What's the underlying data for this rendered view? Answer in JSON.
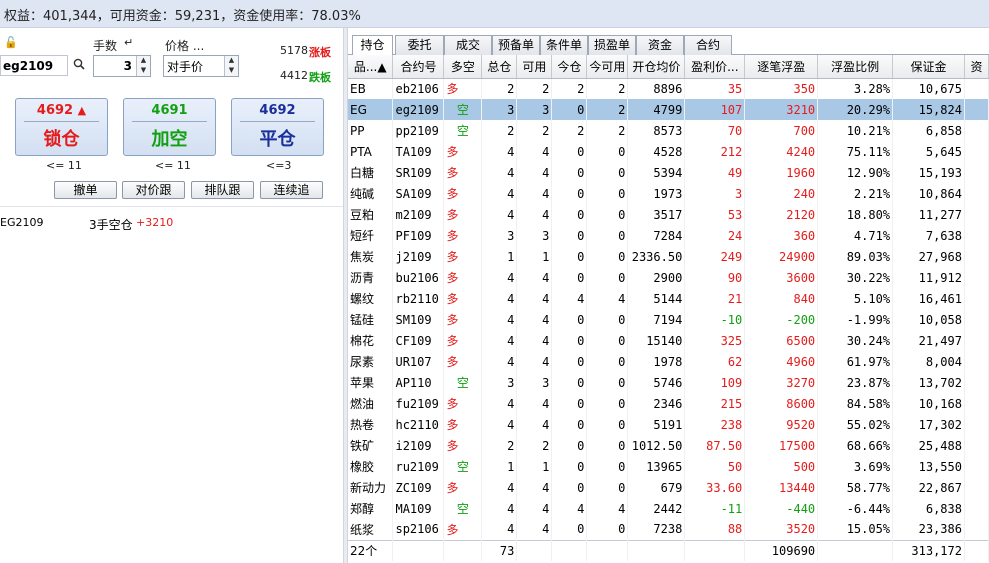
{
  "status": {
    "text": "权益：401,344，可用资金：59,231，资金使用率：78.03%"
  },
  "order": {
    "lock_icon": "lock-icon",
    "symbol": "eg2109",
    "lots_label": "手数",
    "lots": "3",
    "price_label": "价格 ...",
    "price_mode": "对手价",
    "limit_up": "5178",
    "limit_up_label": "涨板",
    "limit_down": "4412",
    "limit_down_label": "跌板",
    "buttons": [
      {
        "price": "4692",
        "title": "锁仓",
        "limit": "<= 11",
        "price_color": "#e51c1c",
        "title_color": "#e51c1c",
        "arrow": "▲"
      },
      {
        "price": "4691",
        "title": "加空",
        "limit": "<= 11",
        "price_color": "#12a012",
        "title_color": "#12a012",
        "arrow": ""
      },
      {
        "price": "4692",
        "title": "平仓",
        "limit": "<=3",
        "price_color": "#1a2f9a",
        "title_color": "#1a2f9a",
        "arrow": ""
      }
    ],
    "small_buttons": [
      "撤单",
      "对价跟",
      "排队跟",
      "连续追"
    ],
    "position": {
      "code": "EG2109",
      "desc": "3手空仓",
      "pl": "+3210"
    }
  },
  "tabs": [
    "持仓",
    "委托",
    "成交",
    "预备单",
    "条件单",
    "损盈单",
    "资金",
    "合约"
  ],
  "table": {
    "headers": [
      "品...▲",
      "合约号",
      "多空",
      "总仓",
      "可用",
      "今仓",
      "今可用",
      "开仓均价",
      "盈利价...",
      "逐笔浮盈",
      "浮盈比例",
      "保证金",
      "资"
    ],
    "rows": [
      [
        "EB",
        "eb2106",
        "多",
        "2",
        "2",
        "2",
        "2",
        "8896",
        "35",
        "350",
        "3.28%",
        "10,675"
      ],
      [
        "EG",
        "eg2109",
        "空",
        "3",
        "3",
        "0",
        "2",
        "4799",
        "107",
        "3210",
        "20.29%",
        "15,824"
      ],
      [
        "PP",
        "pp2109",
        "空",
        "2",
        "2",
        "2",
        "2",
        "8573",
        "70",
        "700",
        "10.21%",
        "6,858"
      ],
      [
        "PTA",
        "TA109",
        "多",
        "4",
        "4",
        "0",
        "0",
        "4528",
        "212",
        "4240",
        "75.11%",
        "5,645"
      ],
      [
        "白糖",
        "SR109",
        "多",
        "4",
        "4",
        "0",
        "0",
        "5394",
        "49",
        "1960",
        "12.90%",
        "15,193"
      ],
      [
        "纯碱",
        "SA109",
        "多",
        "4",
        "4",
        "0",
        "0",
        "1973",
        "3",
        "240",
        "2.21%",
        "10,864"
      ],
      [
        "豆粕",
        "m2109",
        "多",
        "4",
        "4",
        "0",
        "0",
        "3517",
        "53",
        "2120",
        "18.80%",
        "11,277"
      ],
      [
        "短纤",
        "PF109",
        "多",
        "3",
        "3",
        "0",
        "0",
        "7284",
        "24",
        "360",
        "4.71%",
        "7,638"
      ],
      [
        "焦炭",
        "j2109",
        "多",
        "1",
        "1",
        "0",
        "0",
        "2336.50",
        "249",
        "24900",
        "89.03%",
        "27,968"
      ],
      [
        "沥青",
        "bu2106",
        "多",
        "4",
        "4",
        "0",
        "0",
        "2900",
        "90",
        "3600",
        "30.22%",
        "11,912"
      ],
      [
        "螺纹",
        "rb2110",
        "多",
        "4",
        "4",
        "4",
        "4",
        "5144",
        "21",
        "840",
        "5.10%",
        "16,461"
      ],
      [
        "锰硅",
        "SM109",
        "多",
        "4",
        "4",
        "0",
        "0",
        "7194",
        "-10",
        "-200",
        "-1.99%",
        "10,058"
      ],
      [
        "棉花",
        "CF109",
        "多",
        "4",
        "4",
        "0",
        "0",
        "15140",
        "325",
        "6500",
        "30.24%",
        "21,497"
      ],
      [
        "尿素",
        "UR107",
        "多",
        "4",
        "4",
        "0",
        "0",
        "1978",
        "62",
        "4960",
        "61.97%",
        "8,004"
      ],
      [
        "苹果",
        "AP110",
        "空",
        "3",
        "3",
        "0",
        "0",
        "5746",
        "109",
        "3270",
        "23.87%",
        "13,702"
      ],
      [
        "燃油",
        "fu2109",
        "多",
        "4",
        "4",
        "0",
        "0",
        "2346",
        "215",
        "8600",
        "84.58%",
        "10,168"
      ],
      [
        "热卷",
        "hc2110",
        "多",
        "4",
        "4",
        "0",
        "0",
        "5191",
        "238",
        "9520",
        "55.02%",
        "17,302"
      ],
      [
        "铁矿",
        "i2109",
        "多",
        "2",
        "2",
        "0",
        "0",
        "1012.50",
        "87.50",
        "17500",
        "68.66%",
        "25,488"
      ],
      [
        "橡胶",
        "ru2109",
        "空",
        "1",
        "1",
        "0",
        "0",
        "13965",
        "50",
        "500",
        "3.69%",
        "13,550"
      ],
      [
        "新动力",
        "ZC109",
        "多",
        "4",
        "4",
        "0",
        "0",
        "679",
        "33.60",
        "13440",
        "58.77%",
        "22,867"
      ],
      [
        "郑醇",
        "MA109",
        "空",
        "4",
        "4",
        "4",
        "4",
        "2442",
        "-11",
        "-440",
        "-6.44%",
        "6,838"
      ],
      [
        "纸浆",
        "sp2106",
        "多",
        "4",
        "4",
        "0",
        "0",
        "7238",
        "88",
        "3520",
        "15.05%",
        "23,386"
      ]
    ],
    "selected_row": 1,
    "summary": {
      "count": "22个",
      "total": "73",
      "pl": "109690",
      "margin": "313,172"
    }
  },
  "colors": {
    "long": "#e51c1c",
    "short": "#12a012",
    "profit": "#e51c1c",
    "loss": "#12a012"
  }
}
